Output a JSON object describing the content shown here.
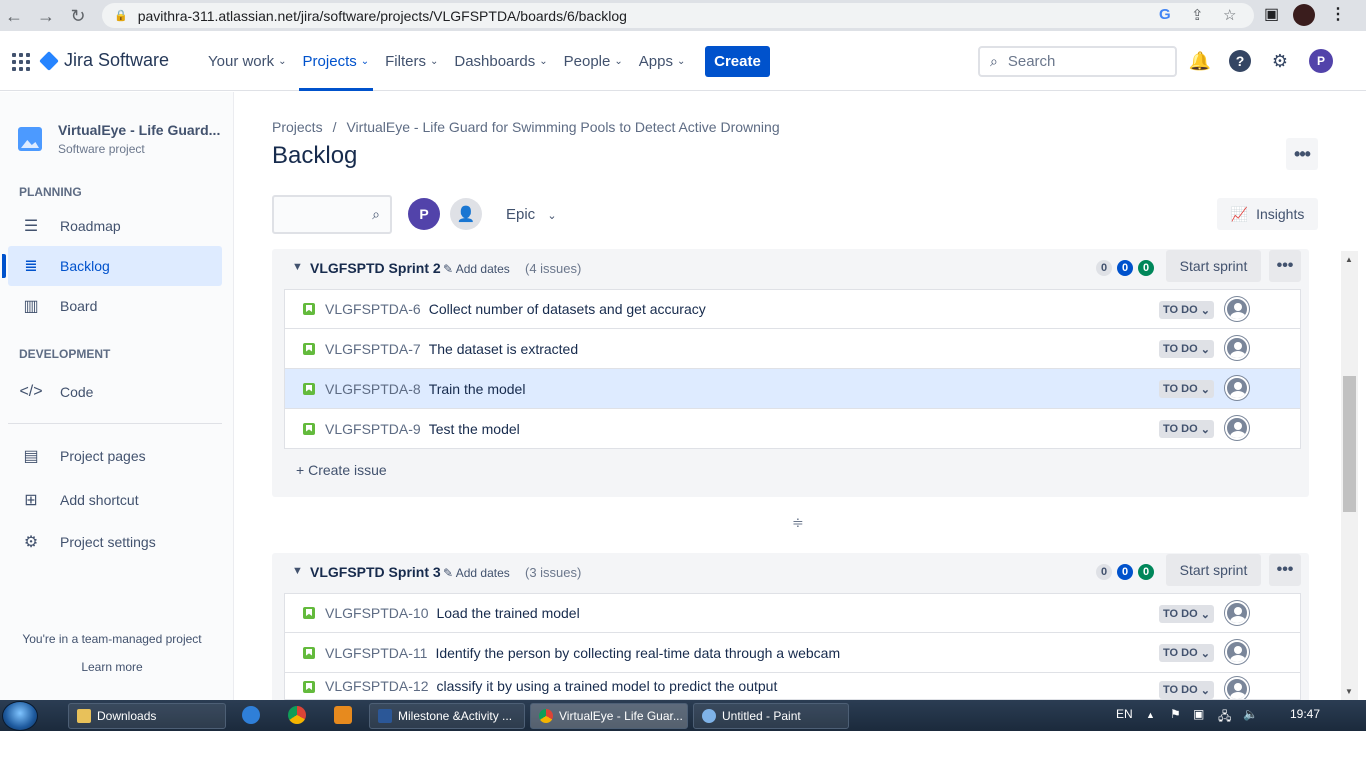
{
  "browser": {
    "url": "pavithra-311.atlassian.net/jira/software/projects/VLGFSPTDA/boards/6/backlog"
  },
  "header": {
    "product": "Jira Software",
    "nav": [
      {
        "label": "Your work",
        "active": false
      },
      {
        "label": "Projects",
        "active": true
      },
      {
        "label": "Filters",
        "active": false
      },
      {
        "label": "Dashboards",
        "active": false
      },
      {
        "label": "People",
        "active": false
      },
      {
        "label": "Apps",
        "active": false
      }
    ],
    "create_label": "Create",
    "search_placeholder": "Search",
    "avatar_initial": "P"
  },
  "sidebar": {
    "project_name": "VirtualEye - Life Guard...",
    "project_type": "Software project",
    "planning_heading": "PLANNING",
    "planning_items": [
      "Roadmap",
      "Backlog",
      "Board"
    ],
    "development_heading": "DEVELOPMENT",
    "dev_items": [
      "Code"
    ],
    "bottom_items": [
      "Project pages",
      "Add shortcut",
      "Project settings"
    ],
    "team_note": "You're in a team-managed project",
    "learn_more": "Learn more"
  },
  "main": {
    "breadcrumb_root": "Projects",
    "breadcrumb_project": "VirtualEye - Life Guard for Swimming Pools to Detect Active Drowning",
    "title": "Backlog",
    "avatar_initial": "P",
    "epic_label": "Epic",
    "insights_label": "Insights",
    "sprints": [
      {
        "name": "VLGFSPTD Sprint 2",
        "add_dates": "Add dates",
        "count": "(4 issues)",
        "stats": [
          "0",
          "0",
          "0"
        ],
        "start_label": "Start sprint",
        "issues": [
          {
            "key": "VLGFSPTDA-6",
            "summary": "Collect number of datasets and get accuracy",
            "status": "TO DO",
            "selected": false
          },
          {
            "key": "VLGFSPTDA-7",
            "summary": "The dataset is extracted",
            "status": "TO DO",
            "selected": false
          },
          {
            "key": "VLGFSPTDA-8",
            "summary": "Train the model",
            "status": "TO DO",
            "selected": true
          },
          {
            "key": "VLGFSPTDA-9",
            "summary": "Test the model",
            "status": "TO DO",
            "selected": false
          }
        ],
        "create_issue": "Create issue"
      },
      {
        "name": "VLGFSPTD Sprint 3",
        "add_dates": "Add dates",
        "count": "(3 issues)",
        "stats": [
          "0",
          "0",
          "0"
        ],
        "start_label": "Start sprint",
        "issues": [
          {
            "key": "VLGFSPTDA-10",
            "summary": "Load the trained model",
            "status": "TO DO",
            "selected": false
          },
          {
            "key": "VLGFSPTDA-11",
            "summary": "Identify the person by collecting real-time data through a webcam",
            "status": "TO DO",
            "selected": false
          },
          {
            "key": "VLGFSPTDA-12",
            "summary": "classify it by using a trained model to predict the output",
            "status": "TO DO",
            "selected": false
          }
        ]
      }
    ]
  },
  "taskbar": {
    "items": [
      "Downloads",
      "Milestone &Activity ...",
      "VirtualEye - Life Guar...",
      "Untitled - Paint"
    ],
    "lang": "EN",
    "time": "19:47"
  }
}
